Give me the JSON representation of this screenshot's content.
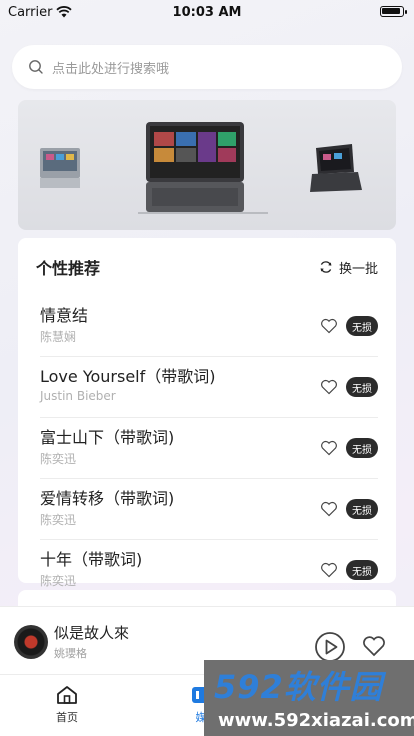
{
  "status_bar": {
    "carrier": "Carrier",
    "time": "10:03 AM"
  },
  "search": {
    "placeholder": "点击此处进行搜索哦"
  },
  "recommend": {
    "title": "个性推荐",
    "refresh_label": "换一批",
    "songs": [
      {
        "title": "情意结",
        "artist": "陈慧娴",
        "badge": "无损"
      },
      {
        "title": "Love Yourself（带歌词)",
        "artist": "Justin Bieber",
        "badge": "无损"
      },
      {
        "title": "富士山下（带歌词)",
        "artist": "陈奕迅",
        "badge": "无损"
      },
      {
        "title": "爱情转移（带歌词)",
        "artist": "陈奕迅",
        "badge": "无损"
      },
      {
        "title": "十年（带歌词)",
        "artist": "陈奕迅",
        "badge": "无损"
      }
    ]
  },
  "player": {
    "title": "似是故人來",
    "artist": "姚瓔格"
  },
  "tabs": {
    "home": "首页",
    "media": "媒"
  },
  "watermark": {
    "brand": "592软件园",
    "url": "www.592xiazai.com"
  },
  "colors": {
    "accent": "#1f7ae0",
    "badge_bg": "#2b2b2b"
  }
}
